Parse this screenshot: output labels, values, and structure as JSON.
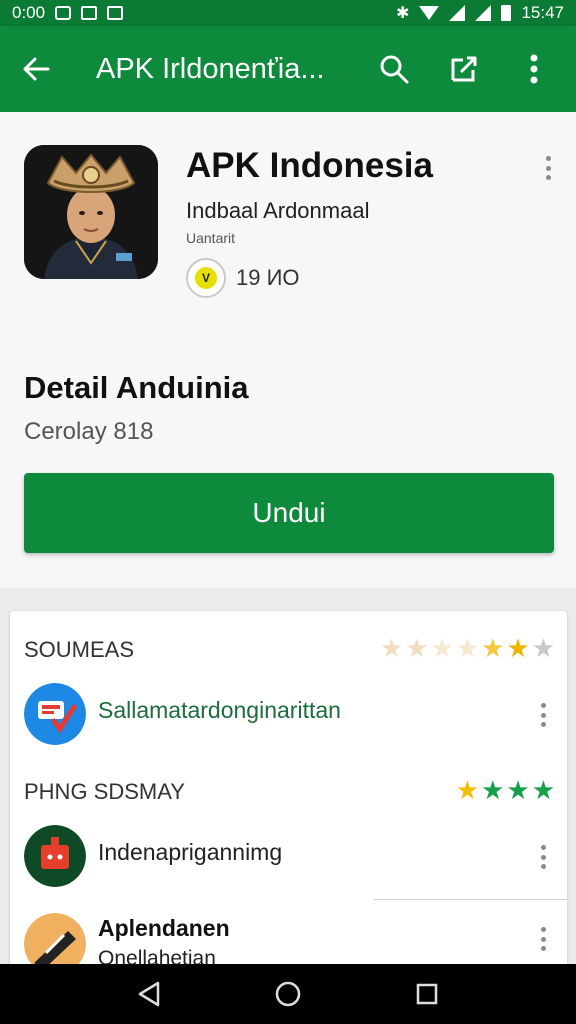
{
  "status_bar": {
    "time_left": "0:00",
    "time_right": "15:47"
  },
  "app_bar": {
    "title": "APK Irldonenťia...",
    "icons": [
      "back-arrow-icon",
      "search-icon",
      "share-icon",
      "more-vert-icon"
    ]
  },
  "app": {
    "title": "APK Indonesia",
    "developer": "Indbaal Ardonmaal",
    "category": "Uantarit",
    "badge_glyph": "V",
    "badge_value": "19 ИO"
  },
  "detail": {
    "title": "Detail Anduinia",
    "size": "Cerolay 818",
    "install_label": "Undui"
  },
  "list": {
    "sections": [
      {
        "heading": "SOUMEAS",
        "stars": [
          "★",
          "★",
          "★",
          "★",
          "★",
          "★"
        ],
        "star_colors": [
          "#f1dcc0",
          "#f1dcc0",
          "#f7e7cf",
          "#f7e7cf",
          "#f3c640",
          "#f0b400",
          "#c8c8c8"
        ],
        "item": {
          "label": "Sallamatardonginarittan",
          "label_color": "#1b6d3a"
        }
      },
      {
        "heading": "PHNG SDSMAY",
        "stars": [
          "★",
          "★",
          "★",
          "★"
        ],
        "star_colors": [
          "#f0c000",
          "#17a04a",
          "#17a04a",
          "#17a04a"
        ],
        "item": {
          "label": "Indenaprigannimg",
          "label_color": "#222222"
        }
      }
    ],
    "last_item": {
      "label": "Aplendanen",
      "sublabel": "Onellahetian"
    }
  },
  "colors": {
    "primary": "#0e8a3d",
    "primary_dark": "#0b7a34"
  }
}
